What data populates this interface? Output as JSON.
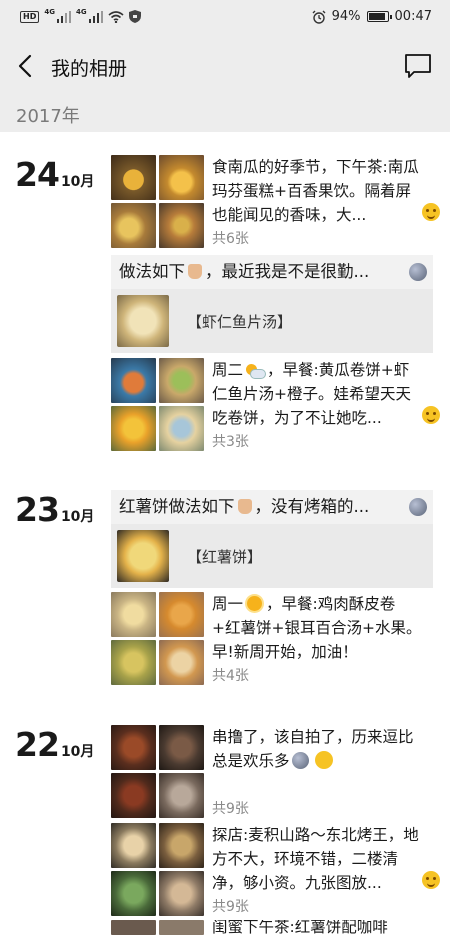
{
  "status": {
    "left_tag": "HD",
    "net1": "4G",
    "net2": "4G",
    "battery": "94%",
    "time": "00:47",
    "battery_level": 0.94
  },
  "header": {
    "title": "我的相册"
  },
  "year": "2017年",
  "days": [
    {
      "day": "24",
      "month": "10月",
      "post1": {
        "text": "食南瓜的好季节，下午茶:南瓜玛芬蛋糕+百香果饮。隔着屏也能闻见的香味，大...",
        "count": "共6张"
      },
      "share": {
        "title": "做法如下",
        "title_rest": "，最近我是不是很勤...",
        "card": "【虾仁鱼片汤】"
      },
      "post2": {
        "text_a": "周二",
        "text_b": "，早餐:黄瓜卷饼+虾仁鱼片汤+橙子。娃希望天天吃卷饼，为了不让她吃...",
        "count": "共3张"
      }
    },
    {
      "day": "23",
      "month": "10月",
      "share": {
        "title": "红薯饼做法如下",
        "title_rest": "，没有烤箱的...",
        "card": "【红薯饼】"
      },
      "post1": {
        "text_a": "周一",
        "text_b": "，早餐:鸡肉酥皮卷+红薯饼+银耳百合汤+水果。早!新周开始，加油！",
        "count": "共4张"
      }
    },
    {
      "day": "22",
      "month": "10月",
      "post1": {
        "text": "串撸了，该自拍了，历来逗比总是欢乐多",
        "count": "共9张"
      },
      "post2": {
        "text": "探店:麦积山路～东北烤王，地方不大，环境不错，二楼清净，够小资。九张图放...",
        "count": "共9张"
      },
      "post3": {
        "text": "闺蜜下午茶:红薯饼配咖啡"
      }
    }
  ]
}
